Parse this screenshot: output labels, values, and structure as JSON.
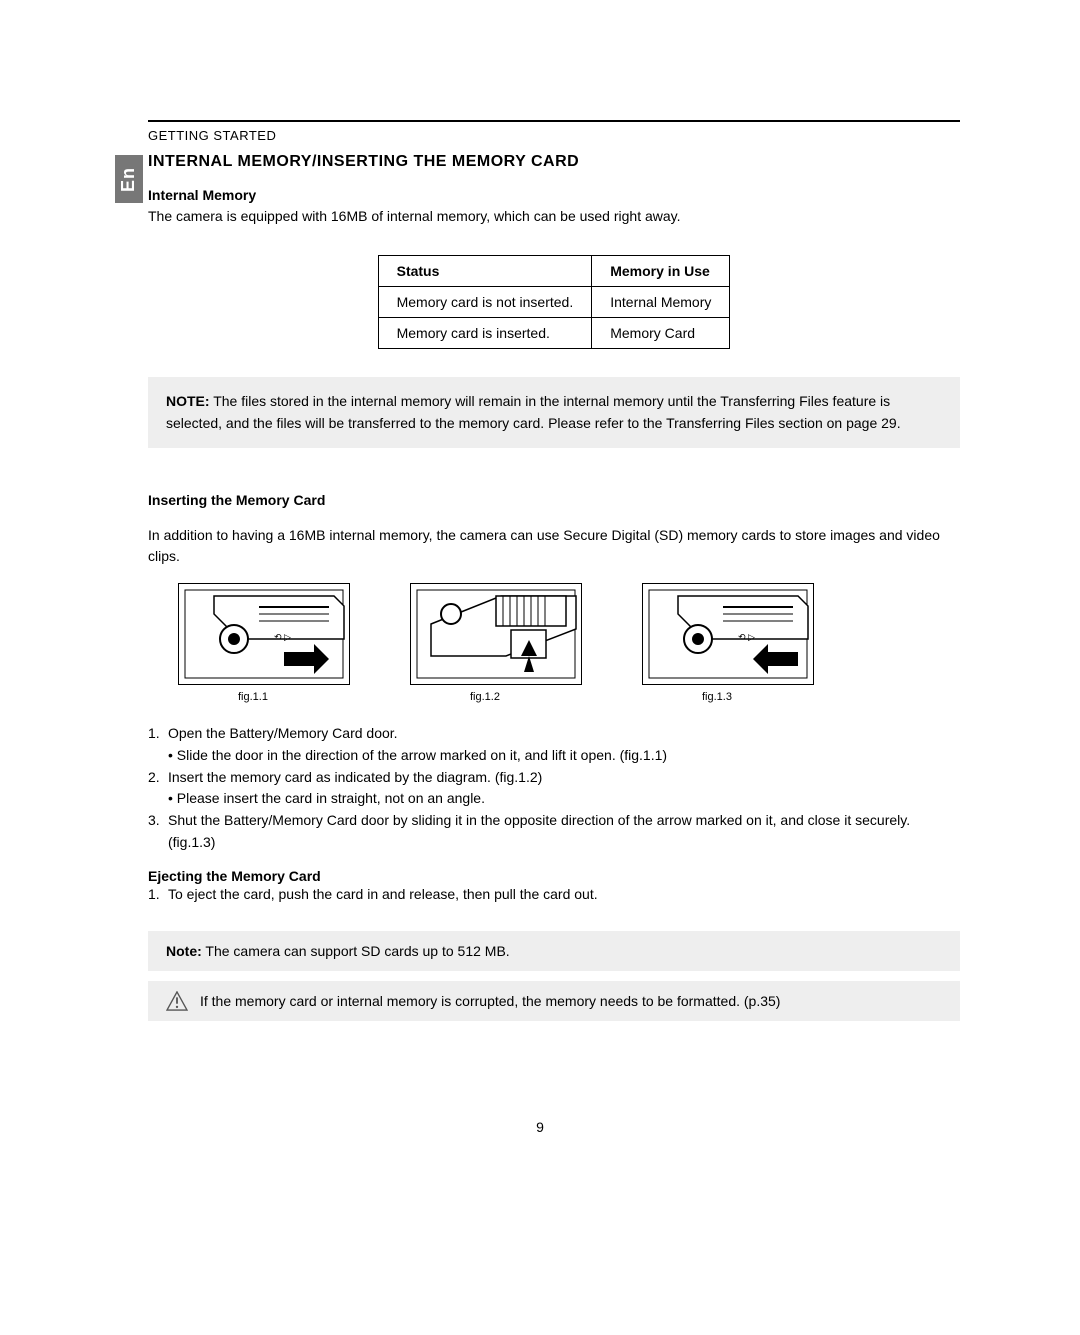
{
  "header": "GETTING STARTED",
  "lang_tab": "En",
  "section_title": "INTERNAL MEMORY/INSERTING THE MEMORY CARD",
  "internal_memory": {
    "title": "Internal Memory",
    "desc": "The camera is equipped with 16MB of internal memory, which can be used right away."
  },
  "table": {
    "headers": {
      "status": "Status",
      "memory": "Memory in Use"
    },
    "rows": [
      {
        "status": "Memory card is not inserted.",
        "memory": "Internal Memory"
      },
      {
        "status": "Memory card is inserted.",
        "memory": "Memory Card"
      }
    ]
  },
  "note1": {
    "label": "NOTE:",
    "text": " The files stored in the internal memory will remain in the internal memory until the Transferring Files feature is selected, and the files will be transferred to the memory card.  Please refer to the Transferring Files section on page 29."
  },
  "inserting": {
    "title": "Inserting the Memory Card",
    "desc": "In addition to having a 16MB internal memory, the camera can use Secure Digital (SD) memory cards to store images and video clips."
  },
  "figs": {
    "f1": "fig.1.1",
    "f2": "fig.1.2",
    "f3": "fig.1.3"
  },
  "steps": {
    "s1": "Open the Battery/Memory Card door.",
    "s1b": "•  Slide the door in the direction of the arrow marked on it, and lift it open. (fig.1.1)",
    "s2": "Insert the memory card as indicated by the diagram. (fig.1.2)",
    "s2b": "•  Please insert the card in straight, not on an angle.",
    "s3": "Shut the Battery/Memory Card door by sliding it in the opposite direction of the arrow marked on it, and close it securely. (fig.1.3)"
  },
  "ejecting": {
    "title": "Ejecting the Memory Card",
    "s1": "To eject the card, push the card in and release, then pull the card out."
  },
  "note2": {
    "label": "Note:",
    "text": " The camera can support SD cards up to 512 MB."
  },
  "warning": "If the memory card or internal memory is corrupted, the memory needs to be formatted. (p.35)",
  "page_number": "9"
}
